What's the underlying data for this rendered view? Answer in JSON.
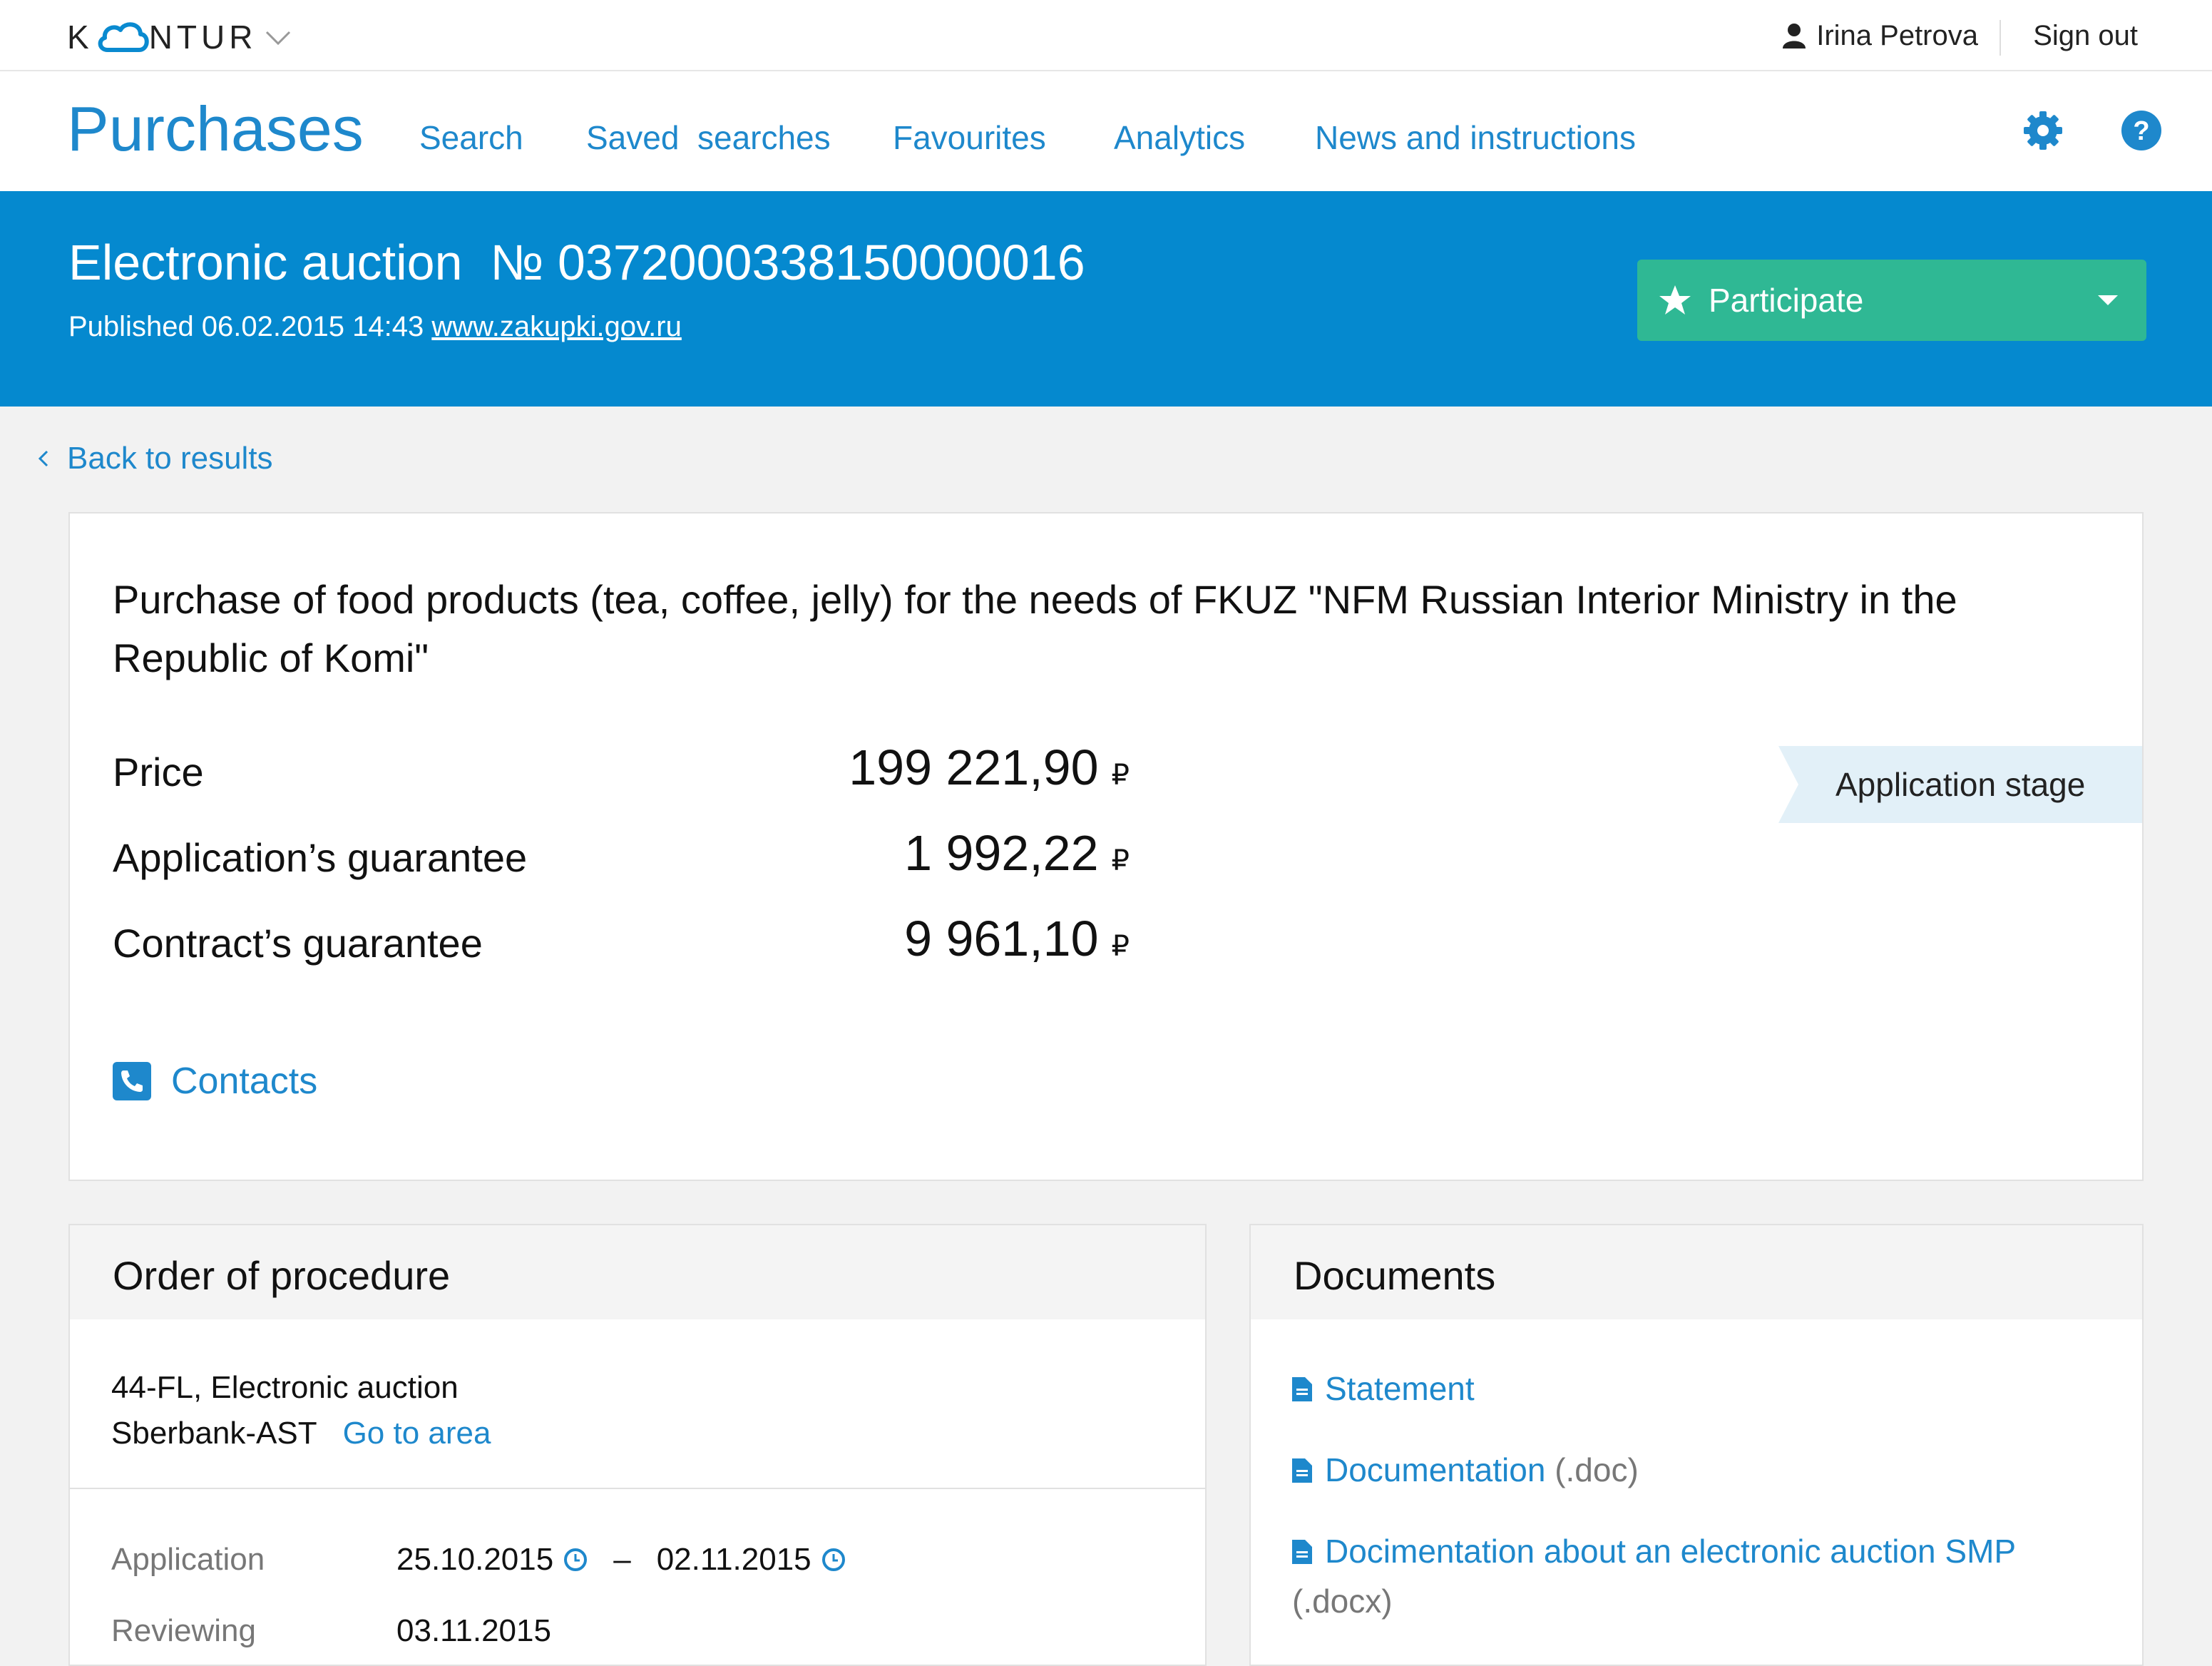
{
  "topbar": {
    "logo_left": "K",
    "logo_right": "NTUR",
    "user_name": "Irina Petrova",
    "sign_out": "Sign out"
  },
  "nav": {
    "brand": "Purchases",
    "items": [
      "Search",
      "Saved  searches",
      "Favourites",
      "Analytics",
      "News and instructions"
    ]
  },
  "hero": {
    "title": "Electronic auction  № 0372000338150000016",
    "published": "Published 06.02.2015 14:43",
    "site_link": "www.zakupki.gov.ru",
    "participate": "Participate"
  },
  "back_link": "Back to results",
  "purchase": {
    "title": "Purchase of food products (tea, coffee, jelly) for the needs of FKUZ \"NFM Russian Interior Ministry in the Republic of Komi\"",
    "rows": [
      {
        "label": "Price",
        "value": "199 221,90",
        "currency": "₽"
      },
      {
        "label": "Application’s guarantee",
        "value": "1 992,22",
        "currency": "₽"
      },
      {
        "label": "Contract’s guarantee",
        "value": "9 961,10",
        "currency": "₽"
      }
    ],
    "stage": "Application stage",
    "contacts": "Contacts"
  },
  "order": {
    "heading": "Order of procedure",
    "law": "44-FL, Electronic auction",
    "platform": "Sberbank-AST",
    "go_to_area": "Go to area",
    "schedule": [
      {
        "label": "Application",
        "from": "25.10.2015",
        "dash": "–",
        "to": "02.11.2015"
      },
      {
        "label": "Reviewing",
        "from": "03.11.2015"
      }
    ]
  },
  "documents": {
    "heading": "Documents",
    "items": [
      {
        "name": "Statement",
        "ext": ""
      },
      {
        "name": "Documentation",
        "ext": "(.doc)"
      },
      {
        "name": "Docimentation about an electronic auction SMP",
        "ext": "(.docx)"
      }
    ]
  },
  "colors": {
    "accent": "#1e88cc",
    "hero_bg": "#0589cf",
    "participate_bg": "#2fb894",
    "stage_bg": "#e2f0f8"
  }
}
